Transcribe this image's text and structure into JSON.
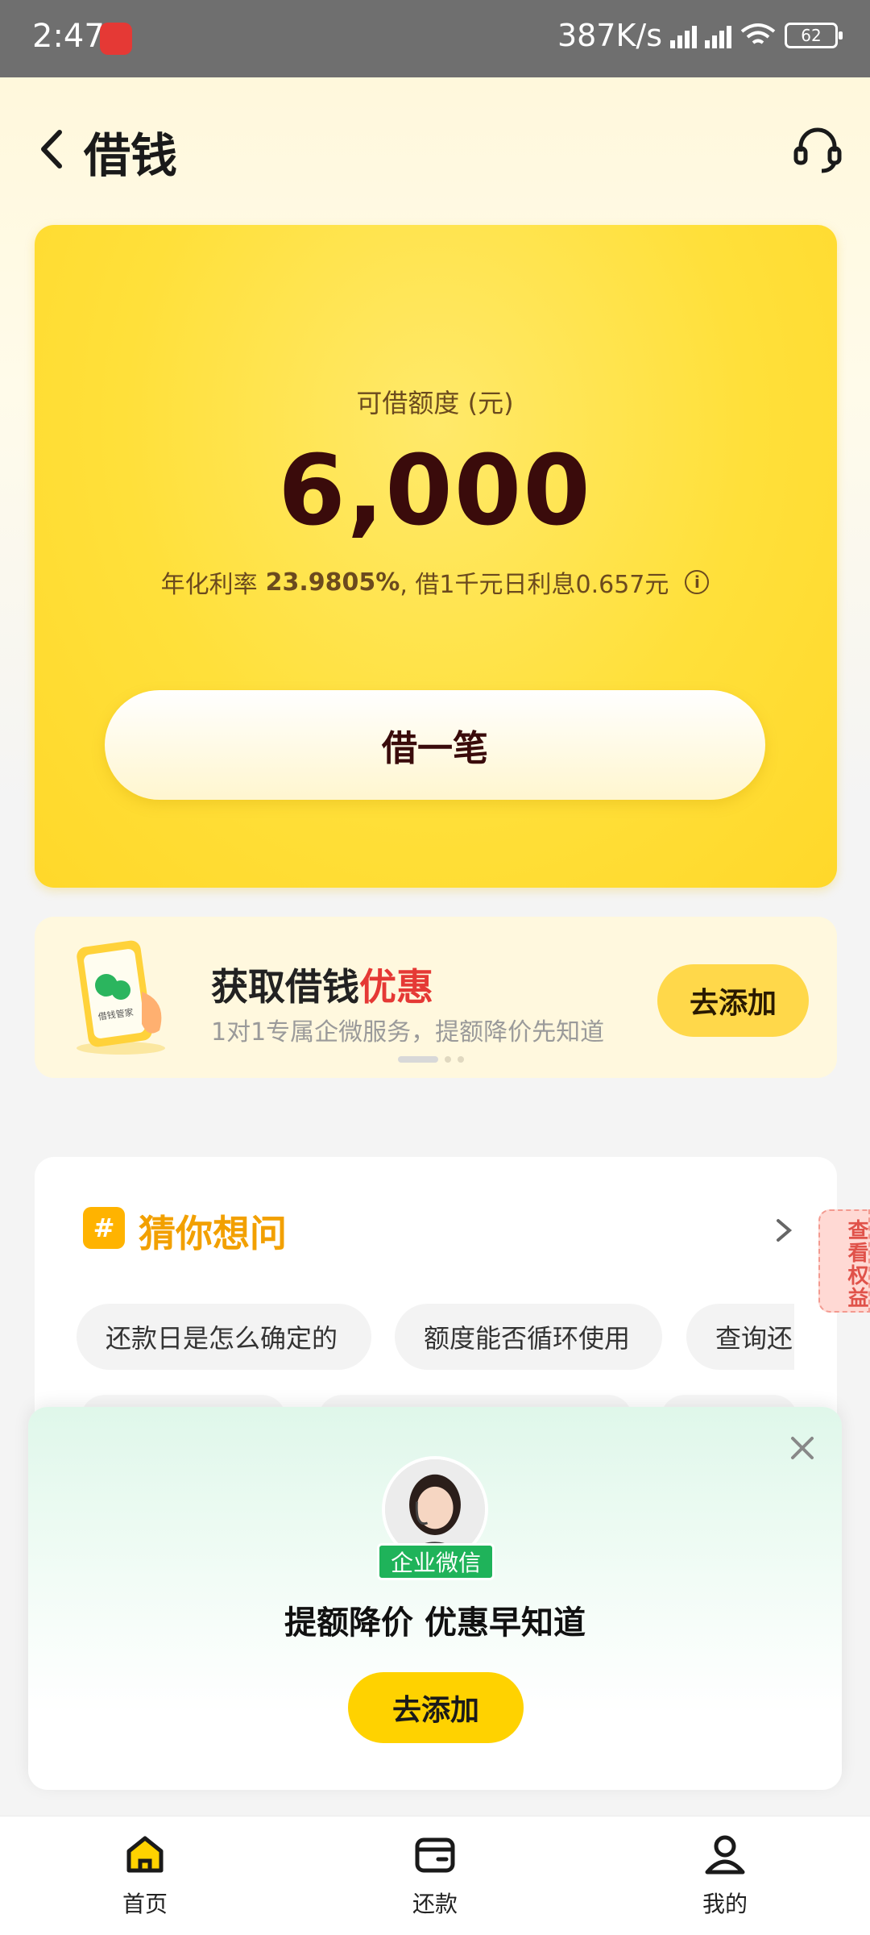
{
  "status_bar": {
    "time": "2:47",
    "network_speed": "387K/s",
    "battery": "62"
  },
  "header": {
    "title": "借钱"
  },
  "quota_card": {
    "label": "可借额度 (元)",
    "amount": "6,000",
    "rate_prefix": "年化利率",
    "rate_value": "23.9805%",
    "rate_suffix": ", 借1千元日利息0.657元",
    "borrow_button": "借一笔",
    "accent_color": "#ffe03a"
  },
  "promo": {
    "title_main": "获取借钱",
    "title_highlight": "优惠",
    "subtitle": "1对1专属企微服务，提额降价先知道",
    "phone_label": "借钱管家",
    "button": "去添加"
  },
  "guess": {
    "title": "猜你想问",
    "chips": [
      "还款日是怎么确定的",
      "额度能否循环使用",
      "查询还"
    ]
  },
  "side_tag": {
    "label": "查看权益"
  },
  "popup": {
    "badge": "企业微信",
    "title": "提额降价 优惠早知道",
    "button": "去添加"
  },
  "bottom_nav": {
    "items": [
      {
        "label": "首页",
        "icon": "home-icon"
      },
      {
        "label": "还款",
        "icon": "wallet-icon"
      },
      {
        "label": "我的",
        "icon": "user-icon"
      }
    ]
  }
}
